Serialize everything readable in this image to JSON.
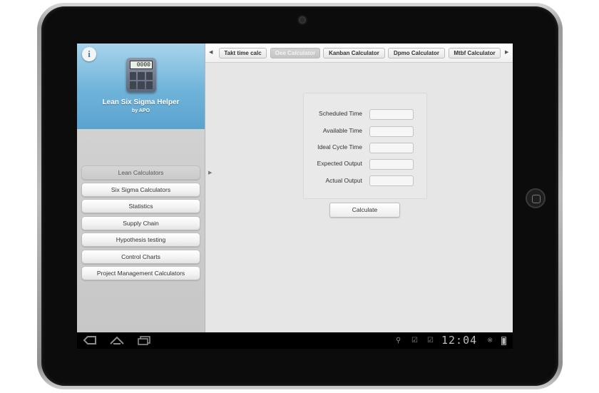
{
  "sidebar": {
    "app_title": "Lean Six Sigma Helper",
    "app_subtitle": "by APO",
    "calc_display": "0000",
    "info_icon": "i",
    "items": [
      {
        "label": "Lean Calculators",
        "active": true
      },
      {
        "label": "Six Sigma Calculators"
      },
      {
        "label": "Statistics"
      },
      {
        "label": "Supply Chain"
      },
      {
        "label": "Hypothesis testing"
      },
      {
        "label": "Control Charts"
      },
      {
        "label": "Project Management Calculators"
      }
    ]
  },
  "tabs": [
    {
      "label": "Takt time calc"
    },
    {
      "label": "Oee Calculator",
      "active": true
    },
    {
      "label": "Kanban Calculator"
    },
    {
      "label": "Dpmo Calculator"
    },
    {
      "label": "Mtbf Calculator"
    }
  ],
  "form": {
    "fields": [
      {
        "label": "Scheduled Time",
        "value": ""
      },
      {
        "label": "Available Time",
        "value": ""
      },
      {
        "label": "Ideal Cycle Time",
        "value": ""
      },
      {
        "label": "Expected Output",
        "value": ""
      },
      {
        "label": "Actual Output",
        "value": ""
      }
    ],
    "calculate_label": "Calculate"
  },
  "statusbar": {
    "clock": "12:04"
  },
  "icons": {
    "back": "back-icon",
    "home": "home-icon",
    "recents": "recent-apps-icon",
    "usb": "usb-icon",
    "notification1": "notification-icon",
    "notification2": "notification-icon",
    "bluetooth": "bluetooth-icon",
    "battery": "battery-icon"
  },
  "colors": {
    "brand_top": "#a8d4ec",
    "brand_bottom": "#5aa3cf"
  }
}
